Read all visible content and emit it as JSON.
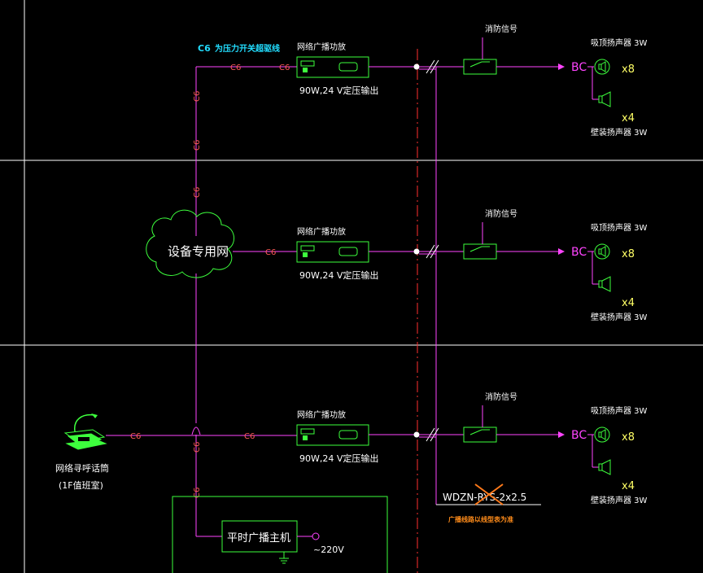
{
  "note_top": {
    "code": "C6",
    "text": "为压力开关超驱线"
  },
  "cable_code": "C6",
  "cloud_label": "设备专用网",
  "amplifier": {
    "name": "网络广播功放",
    "spec": "90W,24 V定压输出"
  },
  "fire_signal": "消防信号",
  "ceiling_speaker": {
    "label": "吸顶扬声器 3W",
    "count": "x8"
  },
  "wall_speaker": {
    "label": "壁装扬声器 3W",
    "count": "x4"
  },
  "bc_label": "BC",
  "paging_mic": {
    "name": "网络寻呼话筒",
    "location": "(1F值班室)"
  },
  "host": {
    "name": "平时广播主机",
    "power": "~220V"
  },
  "cable_spec": "WDZN-RYS-2x2.5",
  "cable_note": "广播线路以线型表为准",
  "colors": {
    "green": "#3dff3d",
    "magenta": "#ff44ff",
    "red": "#ff5a5a",
    "white": "#ffffff",
    "cyan": "#22ddff",
    "orange": "#ff8c1a",
    "yellow": "#ffff66"
  }
}
